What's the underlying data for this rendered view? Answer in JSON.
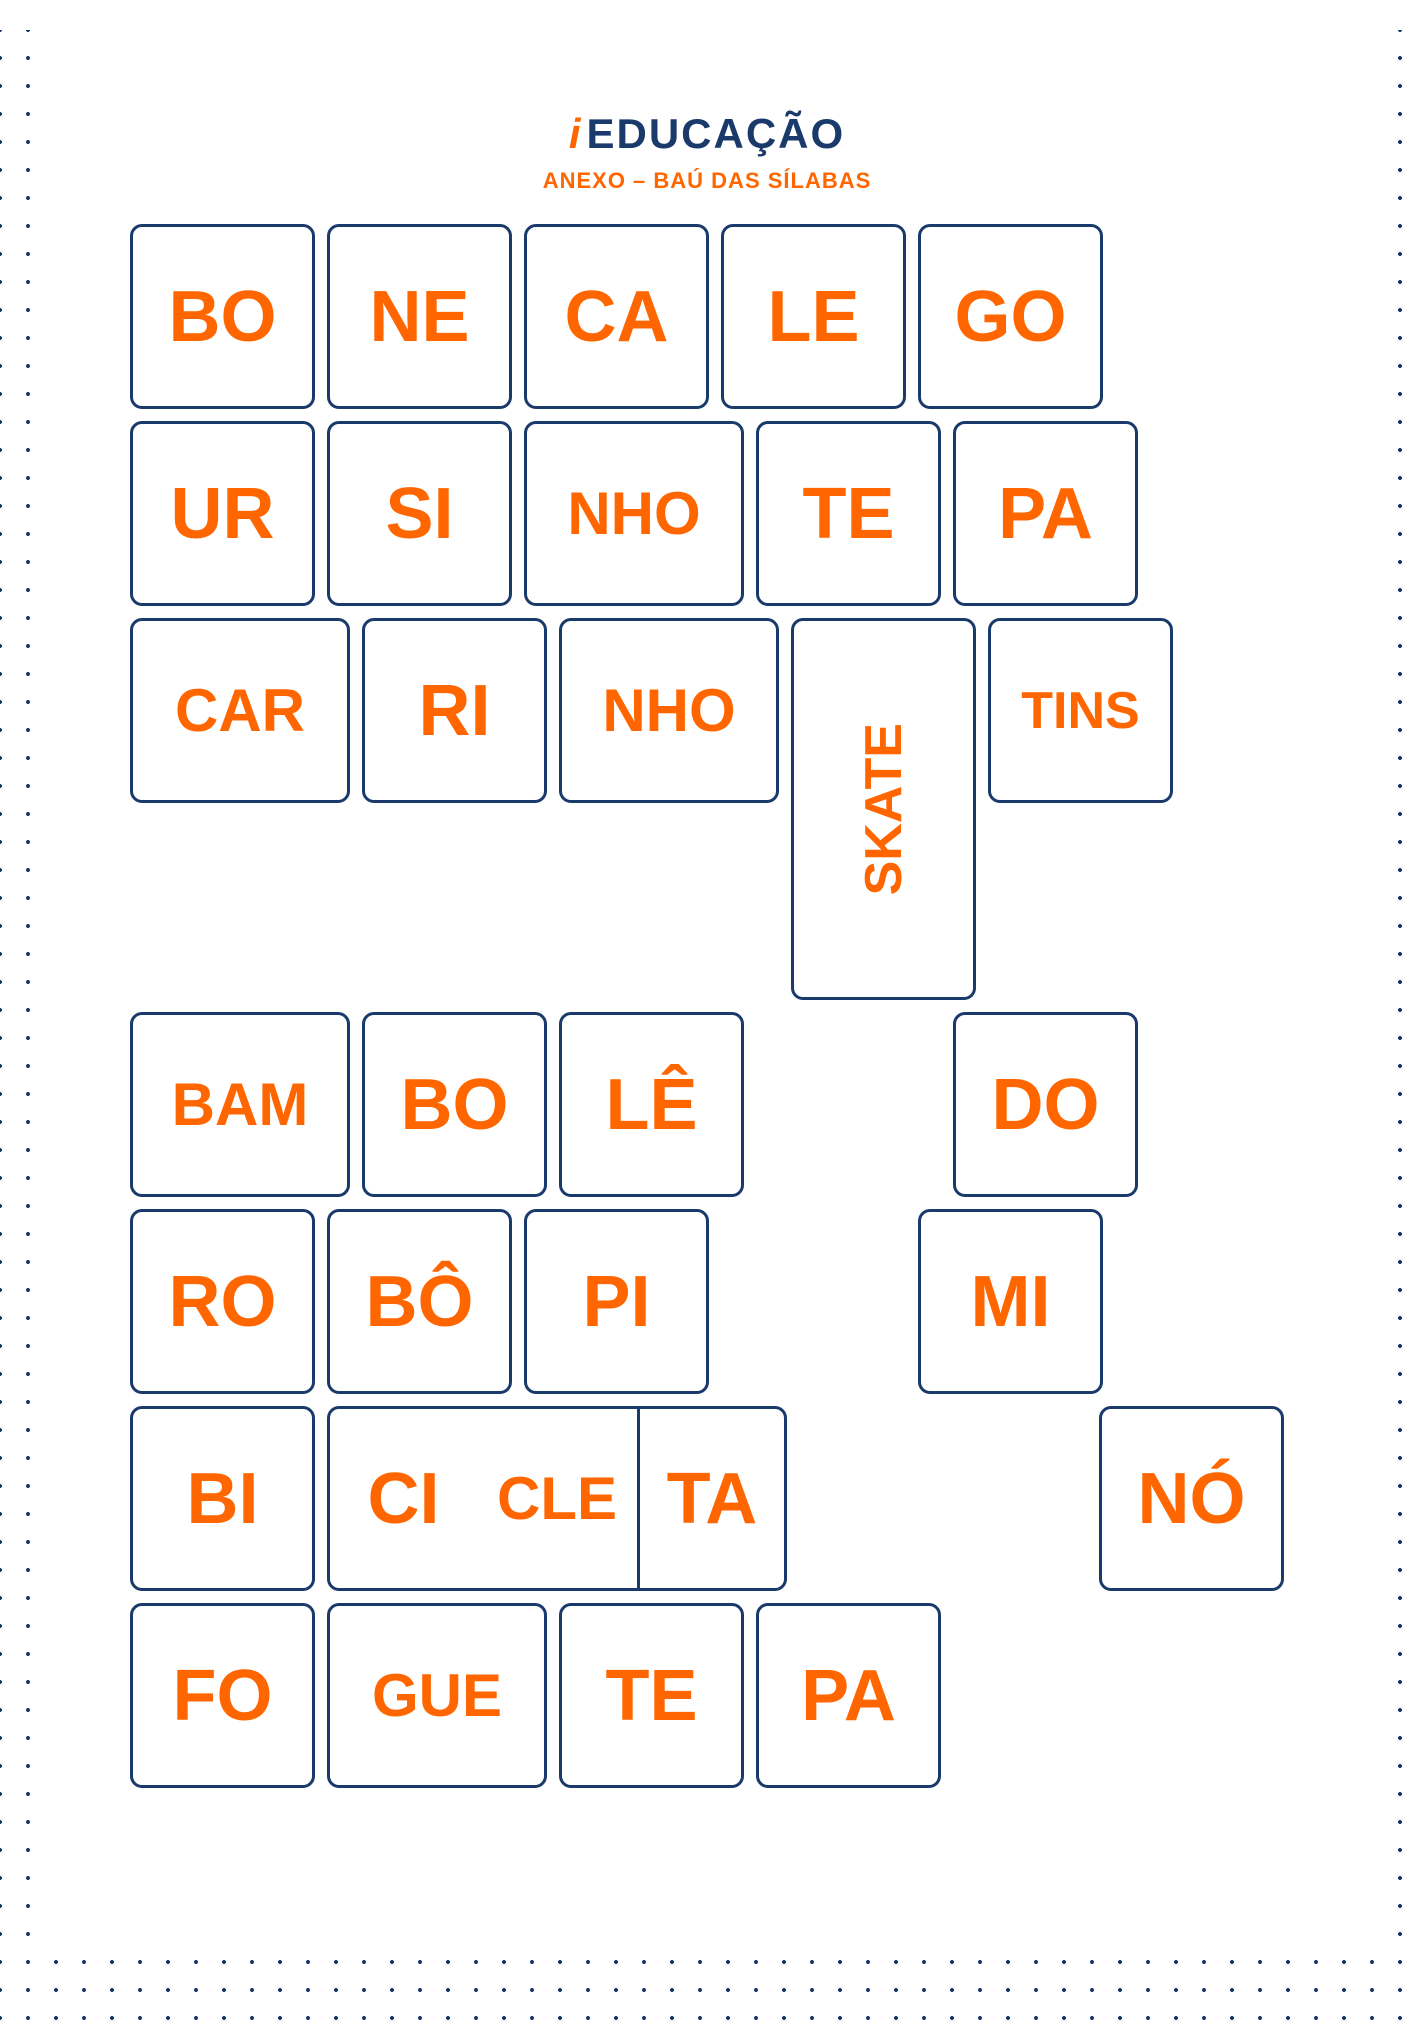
{
  "logo": {
    "icon": "i",
    "text": "EDUCAÇÃO"
  },
  "subtitle": "ANEXO – BAÚ DAS SÍLABAS",
  "rows": [
    {
      "id": "row1",
      "cards": [
        {
          "id": "bo1",
          "text": "BO",
          "type": "std"
        },
        {
          "id": "ne",
          "text": "NE",
          "type": "std"
        },
        {
          "id": "ca1",
          "text": "CA",
          "type": "std"
        },
        {
          "id": "le",
          "text": "LE",
          "type": "std"
        },
        {
          "id": "go",
          "text": "GO",
          "type": "std"
        }
      ]
    },
    {
      "id": "row2",
      "cards": [
        {
          "id": "ur",
          "text": "UR",
          "type": "std"
        },
        {
          "id": "si",
          "text": "SI",
          "type": "std"
        },
        {
          "id": "nho1",
          "text": "NHO",
          "type": "wide"
        },
        {
          "id": "te1",
          "text": "TE",
          "type": "std"
        },
        {
          "id": "pa1",
          "text": "PA",
          "type": "std"
        }
      ]
    },
    {
      "id": "row3",
      "cards": [
        {
          "id": "car",
          "text": "CAR",
          "type": "wide"
        },
        {
          "id": "ri",
          "text": "RI",
          "type": "std"
        },
        {
          "id": "nho2",
          "text": "NHO",
          "type": "wide"
        },
        {
          "id": "skate",
          "text": "SKATE",
          "type": "tall_rotated"
        },
        {
          "id": "tins",
          "text": "TINS",
          "type": "std"
        }
      ]
    },
    {
      "id": "row4",
      "cards": [
        {
          "id": "bam",
          "text": "BAM",
          "type": "wide"
        },
        {
          "id": "bo2",
          "text": "BO",
          "type": "std"
        },
        {
          "id": "le2",
          "text": "LÊ",
          "type": "std"
        },
        {
          "id": "do",
          "text": "DO",
          "type": "std",
          "col": 5
        }
      ]
    },
    {
      "id": "row5",
      "cards": [
        {
          "id": "ro",
          "text": "RO",
          "type": "std"
        },
        {
          "id": "bo3",
          "text": "BÔ",
          "type": "std"
        },
        {
          "id": "pi",
          "text": "PI",
          "type": "std"
        },
        {
          "id": "mi",
          "text": "MI",
          "type": "std",
          "col": 5
        }
      ]
    },
    {
      "id": "row6",
      "cards": [
        {
          "id": "bi",
          "text": "BI",
          "type": "std"
        },
        {
          "id": "ci",
          "text": "CI",
          "type": "connected"
        },
        {
          "id": "cle",
          "text": "CLE",
          "type": "connected"
        },
        {
          "id": "ta",
          "text": "TA",
          "type": "connected_end"
        },
        {
          "id": "no",
          "text": "NÓ",
          "type": "std",
          "col": 5
        }
      ]
    },
    {
      "id": "row7",
      "cards": [
        {
          "id": "fo",
          "text": "FO",
          "type": "std"
        },
        {
          "id": "gue",
          "text": "GUE",
          "type": "wide"
        },
        {
          "id": "te2",
          "text": "TE",
          "type": "std"
        },
        {
          "id": "pa2",
          "text": "PA",
          "type": "std"
        }
      ]
    }
  ]
}
